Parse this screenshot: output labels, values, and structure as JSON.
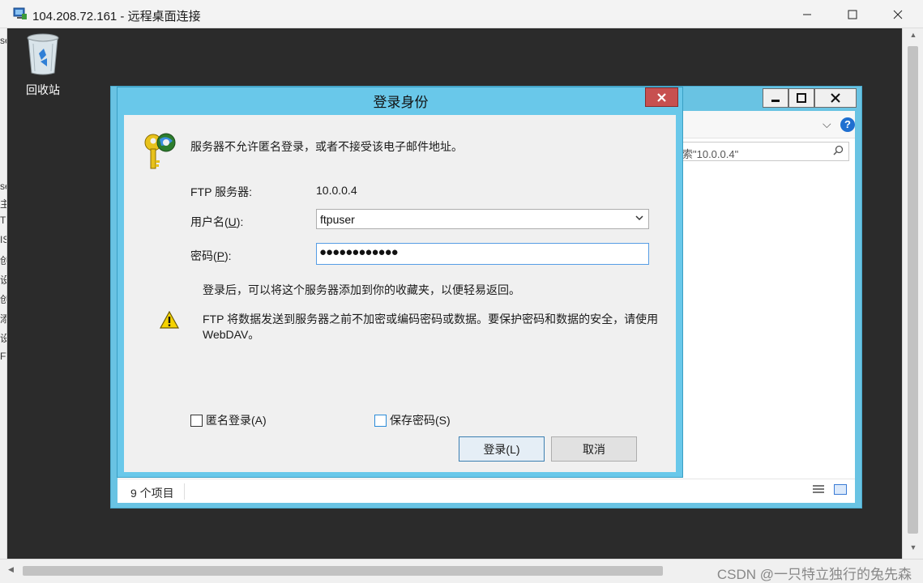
{
  "window": {
    "title": "104.208.72.161 - 远程桌面连接"
  },
  "left_strip": [
    "se",
    "主",
    "T",
    "IS",
    "创",
    "设",
    "创",
    "添",
    "设",
    "FT"
  ],
  "desktop": {
    "recycle_bin_label": "回收站"
  },
  "explorer": {
    "search_text": "索\"10.0.0.4\"",
    "status_count": "9 个项目"
  },
  "dialog": {
    "title": "登录身份",
    "message": "服务器不允许匿名登录，或者不接受该电子邮件地址。",
    "server_label": "FTP 服务器:",
    "server_value": "10.0.0.4",
    "username_label": "用户名",
    "username_mnemonic": "U",
    "username_value": "ftpuser",
    "password_label": "密码",
    "password_mnemonic": "P",
    "password_mask": "●●●●●●●●●●●●",
    "favorites_note": "登录后，可以将这个服务器添加到你的收藏夹，以便轻易返回。",
    "warning_text": "FTP 将数据发送到服务器之前不加密或编码密码或数据。要保护密码和数据的安全，请使用 WebDAV。",
    "anonymous_label": "匿名登录(A)",
    "save_password_label": "保存密码(S)",
    "login_button": "登录(L)",
    "cancel_button": "取消"
  },
  "watermark": "CSDN @一只特立独行的兔先森",
  "colors": {
    "dialog_frame": "#69c8ea",
    "close_red": "#c75050",
    "desktop_bg": "#2b2b2b"
  }
}
